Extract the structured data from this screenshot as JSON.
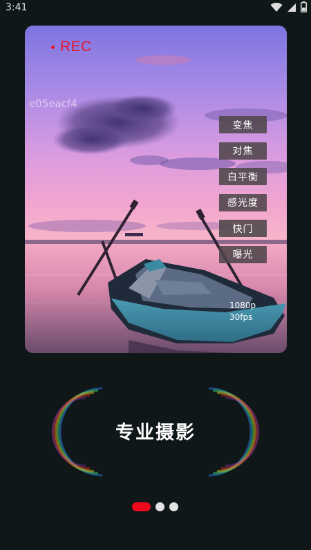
{
  "status_bar": {
    "time": "3:41",
    "icons": [
      "wifi-icon",
      "signal-icon",
      "battery-icon"
    ]
  },
  "preview": {
    "rec_label": "REC",
    "watermark": "e05eacf4",
    "controls": [
      {
        "label": "变焦"
      },
      {
        "label": "对焦"
      },
      {
        "label": "白平衡"
      },
      {
        "label": "感光度"
      },
      {
        "label": "快门"
      },
      {
        "label": "曝光"
      }
    ],
    "resolution": "1080p",
    "framerate": "30fps"
  },
  "feature": {
    "title": "专业摄影"
  },
  "pager": {
    "page_count": 3,
    "active_index": 0
  },
  "colors": {
    "background": "#0f1719",
    "rec_red": "#e8162b",
    "pager_active": "#ee0a1c",
    "pager_inactive": "#e2e2e2"
  }
}
